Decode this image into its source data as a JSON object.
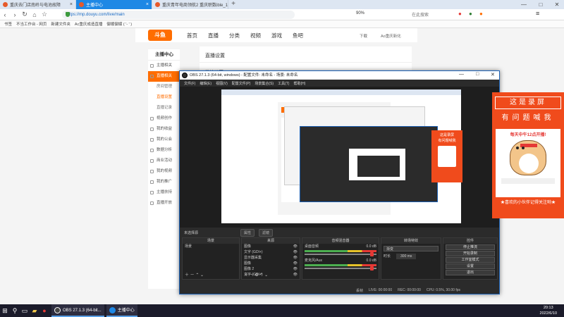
{
  "browser": {
    "tabs": [
      {
        "label": "重庆去门店南岭与电池故障",
        "active": false
      },
      {
        "label": "主播中心",
        "active": true
      },
      {
        "label": "重庆青年电商领航2 重庆职数ible_1",
        "active": false
      }
    ],
    "new_tab": "+",
    "url": "https://mp.douyu.com/live/main",
    "zoom": "90%",
    "search_placeholder": "在此搜索",
    "bookmarks": [
      "书签",
      "不当工作台 - 网页",
      "新建文件夹",
      "Ac重庆成造直播",
      "御顺御媒 ( '- ' )"
    ],
    "window_buttons": [
      "—",
      "□",
      "✕"
    ]
  },
  "douyu": {
    "logo": "斗鱼",
    "nav": [
      "首页",
      "直播",
      "分类",
      "视频",
      "游戏",
      "鱼吧"
    ],
    "right": [
      "下载",
      "Ao重庆新化"
    ],
    "sidebar_title": "主播中心",
    "sidebar": [
      {
        "label": "主播相关",
        "type": "item"
      },
      {
        "label": "直播相关",
        "type": "active"
      },
      {
        "label": "房间管理",
        "type": "sub"
      },
      {
        "label": "直播设置",
        "type": "subactive"
      },
      {
        "label": "直播记录",
        "type": "sub"
      },
      {
        "label": "视频创作",
        "type": "item"
      },
      {
        "label": "我的收益",
        "type": "item"
      },
      {
        "label": "我的公会",
        "type": "item"
      },
      {
        "label": "数据分析",
        "type": "item"
      },
      {
        "label": "商业活动",
        "type": "item"
      },
      {
        "label": "我的视频",
        "type": "item"
      },
      {
        "label": "我的推广",
        "type": "item"
      },
      {
        "label": "主播扶持",
        "type": "item"
      },
      {
        "label": "直播开放",
        "type": "item"
      }
    ],
    "content_title": "直播设置",
    "content_subtitle": "推流设置"
  },
  "obs": {
    "title": "OBS 27.1.3 (64-bit, windows) - 配置文件: 未命名 - 场景: 未命名",
    "window_buttons": [
      "—",
      "□",
      "✕"
    ],
    "menu": [
      "文件(F)",
      "编辑(E)",
      "视图(V)",
      "配置文件(P)",
      "场景集合(S)",
      "工具(T)",
      "帮助(H)"
    ],
    "stream_bar": {
      "label": "未选择源",
      "props": "属性",
      "filters": "滤镜"
    },
    "docks": {
      "scenes": {
        "title": "场景",
        "items": [
          "场景"
        ]
      },
      "sources": {
        "title": "来源",
        "items": [
          "图像",
          "文字 (GDI+)",
          "显示器采集",
          "图像",
          "图像 2",
          "文字 (GDI+)"
        ]
      },
      "mixer": {
        "title": "音频混音器",
        "channels": [
          {
            "name": "桌面音频",
            "db": "0.0 dB"
          },
          {
            "name": "麦克风/Aux",
            "db": "0.0 dB"
          }
        ]
      },
      "transitions": {
        "title": "转场特效",
        "type": "渐变",
        "duration_label": "时长",
        "duration": "300 ms"
      },
      "controls": {
        "title": "控件",
        "buttons": [
          "停止推流",
          "开始录制",
          "工作室模式",
          "设置",
          "退出"
        ]
      }
    },
    "status": {
      "dropped": "丢帧",
      "live": "LIVE: 00:00:00",
      "rec": "REC: 00:00:00",
      "cpu": "CPU: 0.5%, 30.00 fps"
    }
  },
  "banner": {
    "line1": "这是录屏",
    "line2": "有问题喊我",
    "sub": "每天中午12点开播!",
    "foot": "★喜欢的小伙伴记得关注哟★",
    "small_line1": "这是录屏",
    "small_line2": "有问题喊我"
  },
  "taskbar": {
    "apps": [
      "OBS 27.1.3 (64-bit...",
      "主播中心"
    ],
    "time": "20:13",
    "date": "2022/6/10"
  }
}
